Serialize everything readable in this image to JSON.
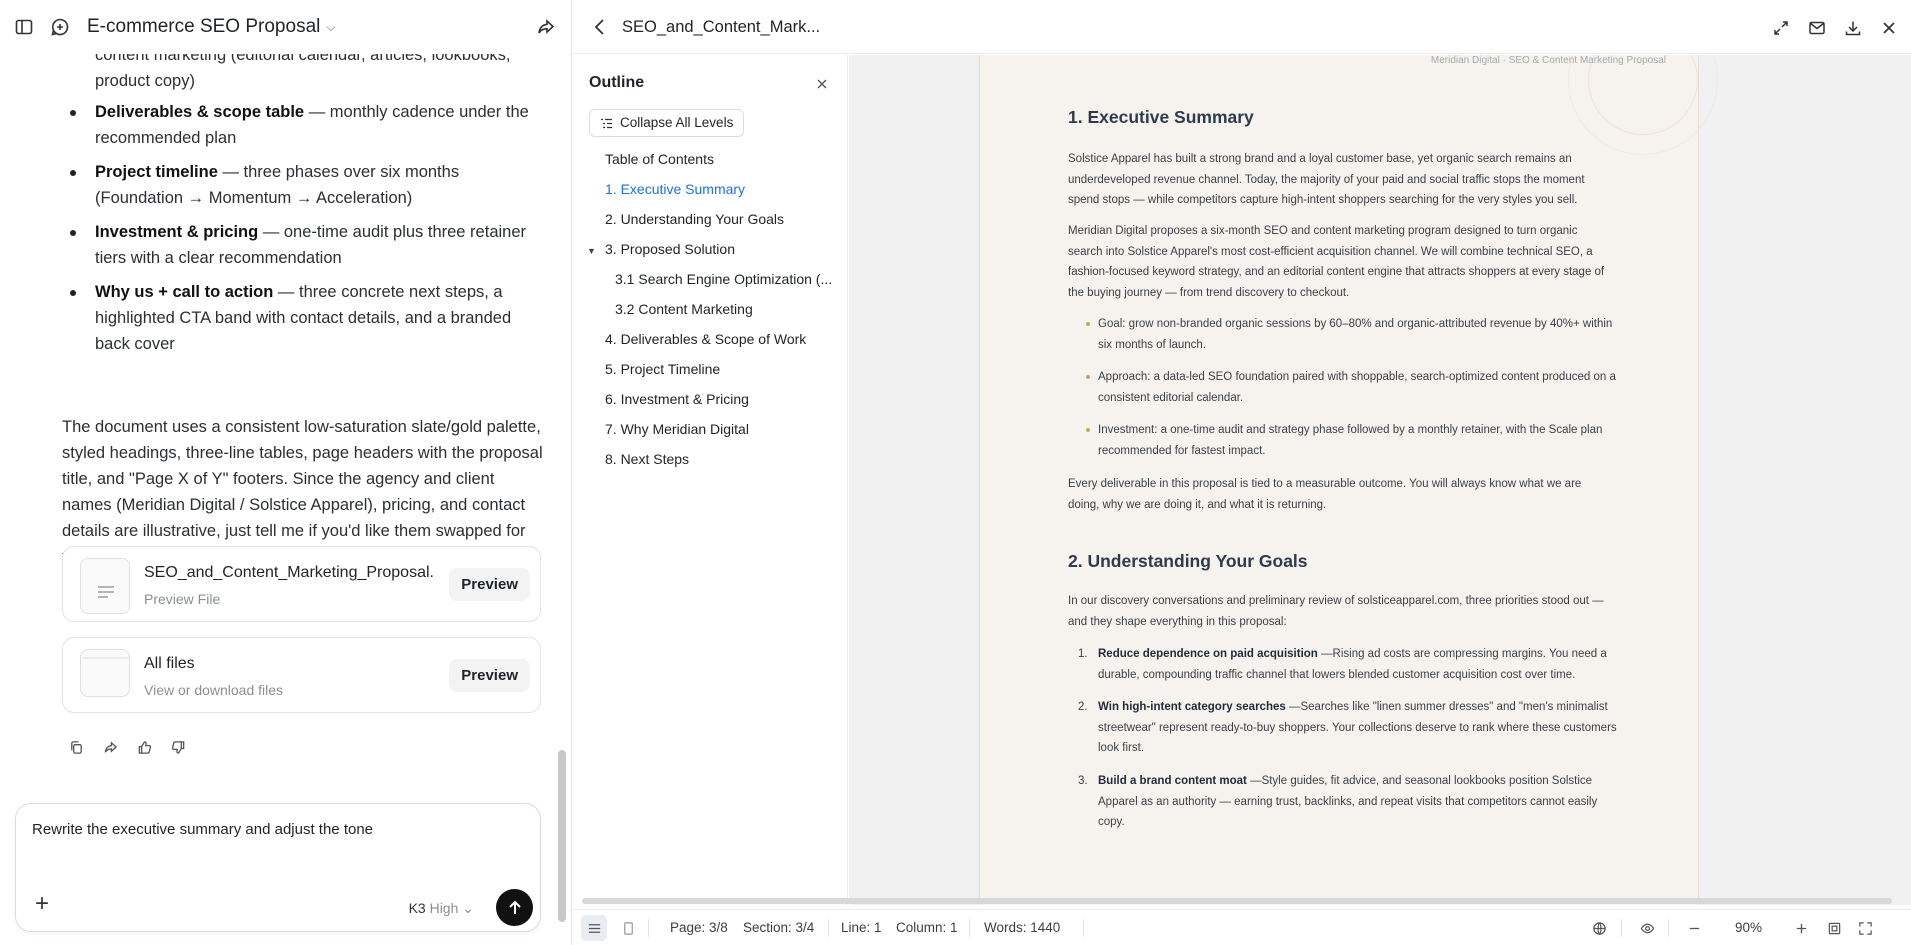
{
  "chat": {
    "title": "E-commerce SEO Proposal",
    "partial_line_1": "content marketing (editorial calendar, articles, lookbooks,",
    "partial_line_2": "product copy)",
    "bullets": [
      {
        "bold": "Deliverables & scope table",
        "rest": " — monthly cadence under the recommended plan"
      },
      {
        "bold": "Project timeline",
        "rest": " — three phases over six months (Foundation → Momentum → Acceleration)"
      },
      {
        "bold": "Investment & pricing",
        "rest": " — one-time audit plus three retainer tiers with a clear recommendation"
      },
      {
        "bold": "Why us + call to action",
        "rest": " — three concrete next steps, a highlighted CTA band with contact details, and a branded back cover"
      }
    ],
    "paragraph": "The document uses a consistent low-saturation slate/gold palette, styled headings, three-line tables, page headers with the proposal title, and \"Page X of Y\" footers. Since the agency and client names (Meridian Digital / Solstice Apparel), pricing, and contact details are illustrative, just tell me if you'd like them swapped for your real business details.",
    "files": [
      {
        "title": "SEO_and_Content_Marketing_Proposal....",
        "subtitle": "Preview File",
        "button": "Preview"
      },
      {
        "title": "All files",
        "subtitle": "View or download files",
        "button": "Preview"
      }
    ],
    "composer": {
      "text": "Rewrite the executive summary and adjust the tone",
      "model": "K3",
      "mode": "High"
    }
  },
  "preview": {
    "title": "SEO_and_Content_Mark...",
    "outline": {
      "title": "Outline",
      "collapse_label": "Collapse All Levels",
      "items": [
        {
          "label": "Table of Contents"
        },
        {
          "label": "1. Executive Summary"
        },
        {
          "label": "2. Understanding Your Goals"
        },
        {
          "label": "3. Proposed Solution"
        },
        {
          "label": "3.1 Search Engine Optimization (..."
        },
        {
          "label": "3.2 Content Marketing"
        },
        {
          "label": "4. Deliverables & Scope of Work"
        },
        {
          "label": "5. Project Timeline"
        },
        {
          "label": "6. Investment & Pricing"
        },
        {
          "label": "7. Why Meridian Digital"
        },
        {
          "label": "8. Next Steps"
        }
      ]
    },
    "document": {
      "header": "Meridian Digital · SEO & Content Marketing Proposal",
      "h1_exec": "1. Executive Summary",
      "p1": "Solstice Apparel has built a strong brand and a loyal customer base, yet organic search remains an underdeveloped revenue channel. Today, the majority of your paid and social traffic stops the moment spend stops — while competitors capture high-intent shoppers searching for the very styles you sell.",
      "p2": "Meridian Digital proposes a six-month SEO and content marketing program designed to turn organic search into Solstice Apparel's most cost-efficient acquisition channel. We will combine technical SEO, a fashion-focused keyword strategy, and an editorial content engine that attracts shoppers at every stage of the buying journey — from trend discovery to checkout.",
      "goal": "Goal: grow non-branded organic sessions by 60–80% and organic-attributed revenue by 40%+ within six months of launch.",
      "approach": "Approach: a data-led SEO foundation paired with shoppable, search-optimized content produced on a consistent editorial calendar.",
      "investment": "Investment: a one-time audit and strategy phase followed by a monthly retainer, with the Scale plan recommended for fastest impact.",
      "p3": "Every deliverable in this proposal is tied to a measurable outcome. You will always know what we are doing, why we are doing it, and what it is returning.",
      "h1_goals": "2. Understanding Your Goals",
      "p4": "In our discovery conversations and preliminary review of solsticeapparel.com, three priorities stood out — and they shape everything in this proposal:",
      "priorities": [
        {
          "n": "1.",
          "bold": "Reduce dependence on paid acquisition",
          "rest": " —Rising ad costs are compressing margins. You need a durable, compounding traffic channel that lowers blended customer acquisition cost over time."
        },
        {
          "n": "2.",
          "bold": "Win high-intent category searches",
          "rest": " —Searches like \"linen summer dresses\" and \"men's minimalist streetwear\" represent ready-to-buy shoppers. Your collections deserve to rank where these customers look first."
        },
        {
          "n": "3.",
          "bold": "Build a brand content moat",
          "rest": " —Style guides, fit advice, and seasonal lookbooks position Solstice Apparel as an authority — earning trust, backlinks, and repeat visits that competitors cannot easily copy."
        }
      ]
    },
    "status": {
      "page": "Page: 3/8",
      "section": "Section: 3/4",
      "line": "Line: 1",
      "column": "Column: 1",
      "words": "Words: 1440",
      "zoom": "90%"
    }
  }
}
